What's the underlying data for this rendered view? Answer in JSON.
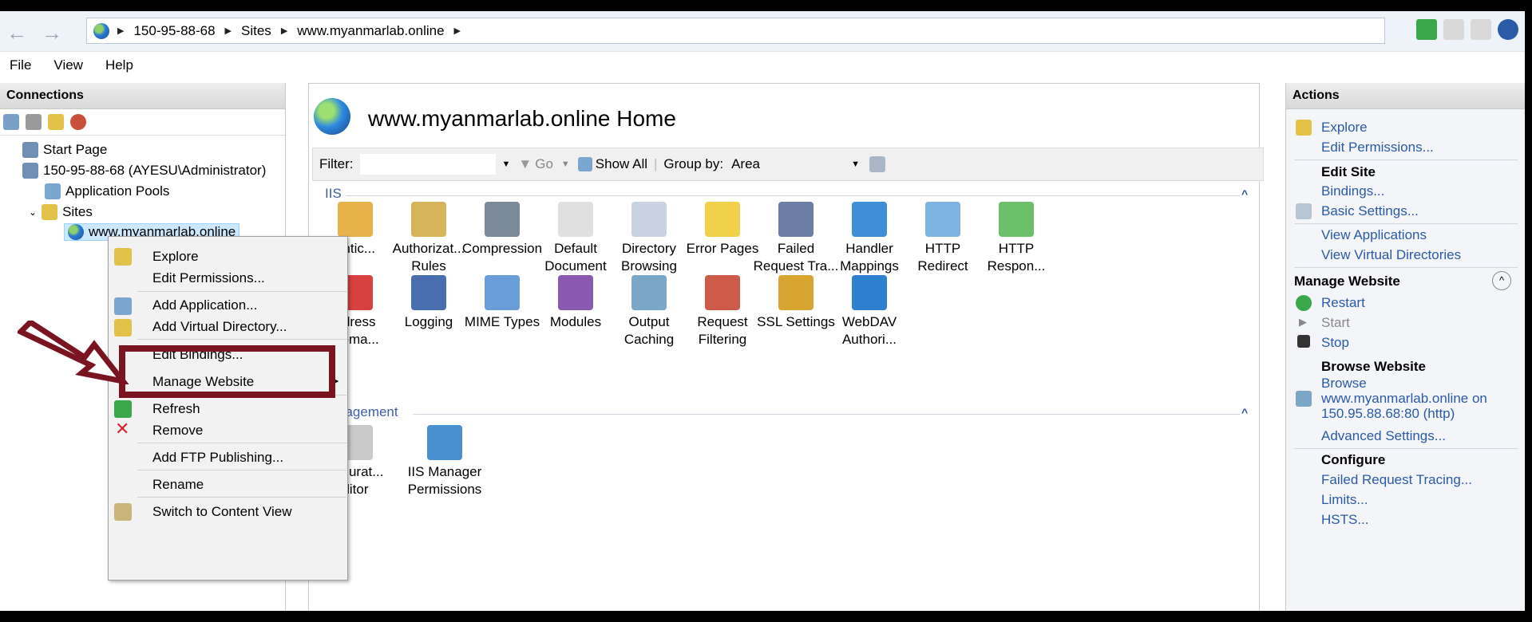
{
  "address": {
    "crumbs": [
      "150-95-88-68",
      "Sites",
      "www.myanmarlab.online"
    ]
  },
  "menubar": [
    "File",
    "View",
    "Help"
  ],
  "connections": {
    "title": "Connections",
    "tree": {
      "start_page": "Start Page",
      "server": "150-95-88-68 (AYESU\\Administrator)",
      "app_pools": "Application Pools",
      "sites": "Sites",
      "site": "www.myanmarlab.online"
    }
  },
  "main": {
    "title": "www.myanmarlab.online Home",
    "filter": {
      "label": "Filter:",
      "go": "Go",
      "show_all": "Show All",
      "group_by_label": "Group by:",
      "group_by_value": "Area"
    },
    "sections": {
      "iis": "IIS",
      "management": "nagement"
    },
    "iis_features_row1": [
      {
        "l1": "entic...",
        "l2": "",
        "color": "#e8b24a"
      },
      {
        "l1": "Authorizat...",
        "l2": "Rules",
        "color": "#d7b45a"
      },
      {
        "l1": "Compression",
        "l2": "",
        "color": "#7a8a99"
      },
      {
        "l1": "Default",
        "l2": "Document",
        "color": "#e0e0e0"
      },
      {
        "l1": "Directory",
        "l2": "Browsing",
        "color": "#c9d3df"
      },
      {
        "l1": "Error Pages",
        "l2": "",
        "color": "#f2d14a"
      },
      {
        "l1": "Failed",
        "l2": "Request Tra...",
        "color": "#6c7ea6"
      },
      {
        "l1": "Handler",
        "l2": "Mappings",
        "color": "#3f8fd8"
      },
      {
        "l1": "HTTP",
        "l2": "Redirect",
        "color": "#7db3e0"
      },
      {
        "l1": "HTTP",
        "l2": "Respon...",
        "color": "#6cc06a"
      }
    ],
    "iis_features_row2": [
      {
        "l1": "ddress",
        "l2": "Doma...",
        "color": "#d94040"
      },
      {
        "l1": "Logging",
        "l2": "",
        "color": "#4a6fb0"
      },
      {
        "l1": "MIME Types",
        "l2": "",
        "color": "#6a9ed8"
      },
      {
        "l1": "Modules",
        "l2": "",
        "color": "#8a5ab0"
      },
      {
        "l1": "Output",
        "l2": "Caching",
        "color": "#7aa6c8"
      },
      {
        "l1": "Request",
        "l2": "Filtering",
        "color": "#d05a4a"
      },
      {
        "l1": "SSL Settings",
        "l2": "",
        "color": "#d8a630"
      },
      {
        "l1": "WebDAV",
        "l2": "Authori...",
        "color": "#2f7fd0"
      }
    ],
    "mgmt_features": [
      {
        "l1": "nfigurat...",
        "l2": "ditor",
        "color": "#c9c9c9"
      },
      {
        "l1": "IIS Manager",
        "l2": "Permissions",
        "color": "#4a8fd0"
      }
    ]
  },
  "actions": {
    "title": "Actions",
    "explore": "Explore",
    "edit_permissions": "Edit Permissions...",
    "edit_site": "Edit Site",
    "bindings": "Bindings...",
    "basic_settings": "Basic Settings...",
    "view_applications": "View Applications",
    "view_virtual_dirs": "View Virtual Directories",
    "manage_website": "Manage Website",
    "restart": "Restart",
    "start": "Start",
    "stop": "Stop",
    "browse_website": "Browse Website",
    "browse": "Browse",
    "browse_url1": "www.myanmarlab.online on",
    "browse_url2": "150.95.88.68:80 (http)",
    "advanced_settings": "Advanced Settings...",
    "configure": "Configure",
    "failed_request_tracing": "Failed Request Tracing...",
    "limits": "Limits...",
    "hsts": "HSTS..."
  },
  "context_menu": {
    "explore": "Explore",
    "edit_permissions": "Edit Permissions...",
    "add_application": "Add Application...",
    "add_virtual_directory": "Add Virtual Directory...",
    "edit_bindings": "Edit Bindings...",
    "manage_website": "Manage Website",
    "refresh": "Refresh",
    "remove": "Remove",
    "add_ftp_publishing": "Add FTP Publishing...",
    "rename": "Rename",
    "switch_to_content_view": "Switch to Content View"
  },
  "colors": {
    "highlight_box": "#7a1420",
    "link": "#2a5aa8"
  }
}
